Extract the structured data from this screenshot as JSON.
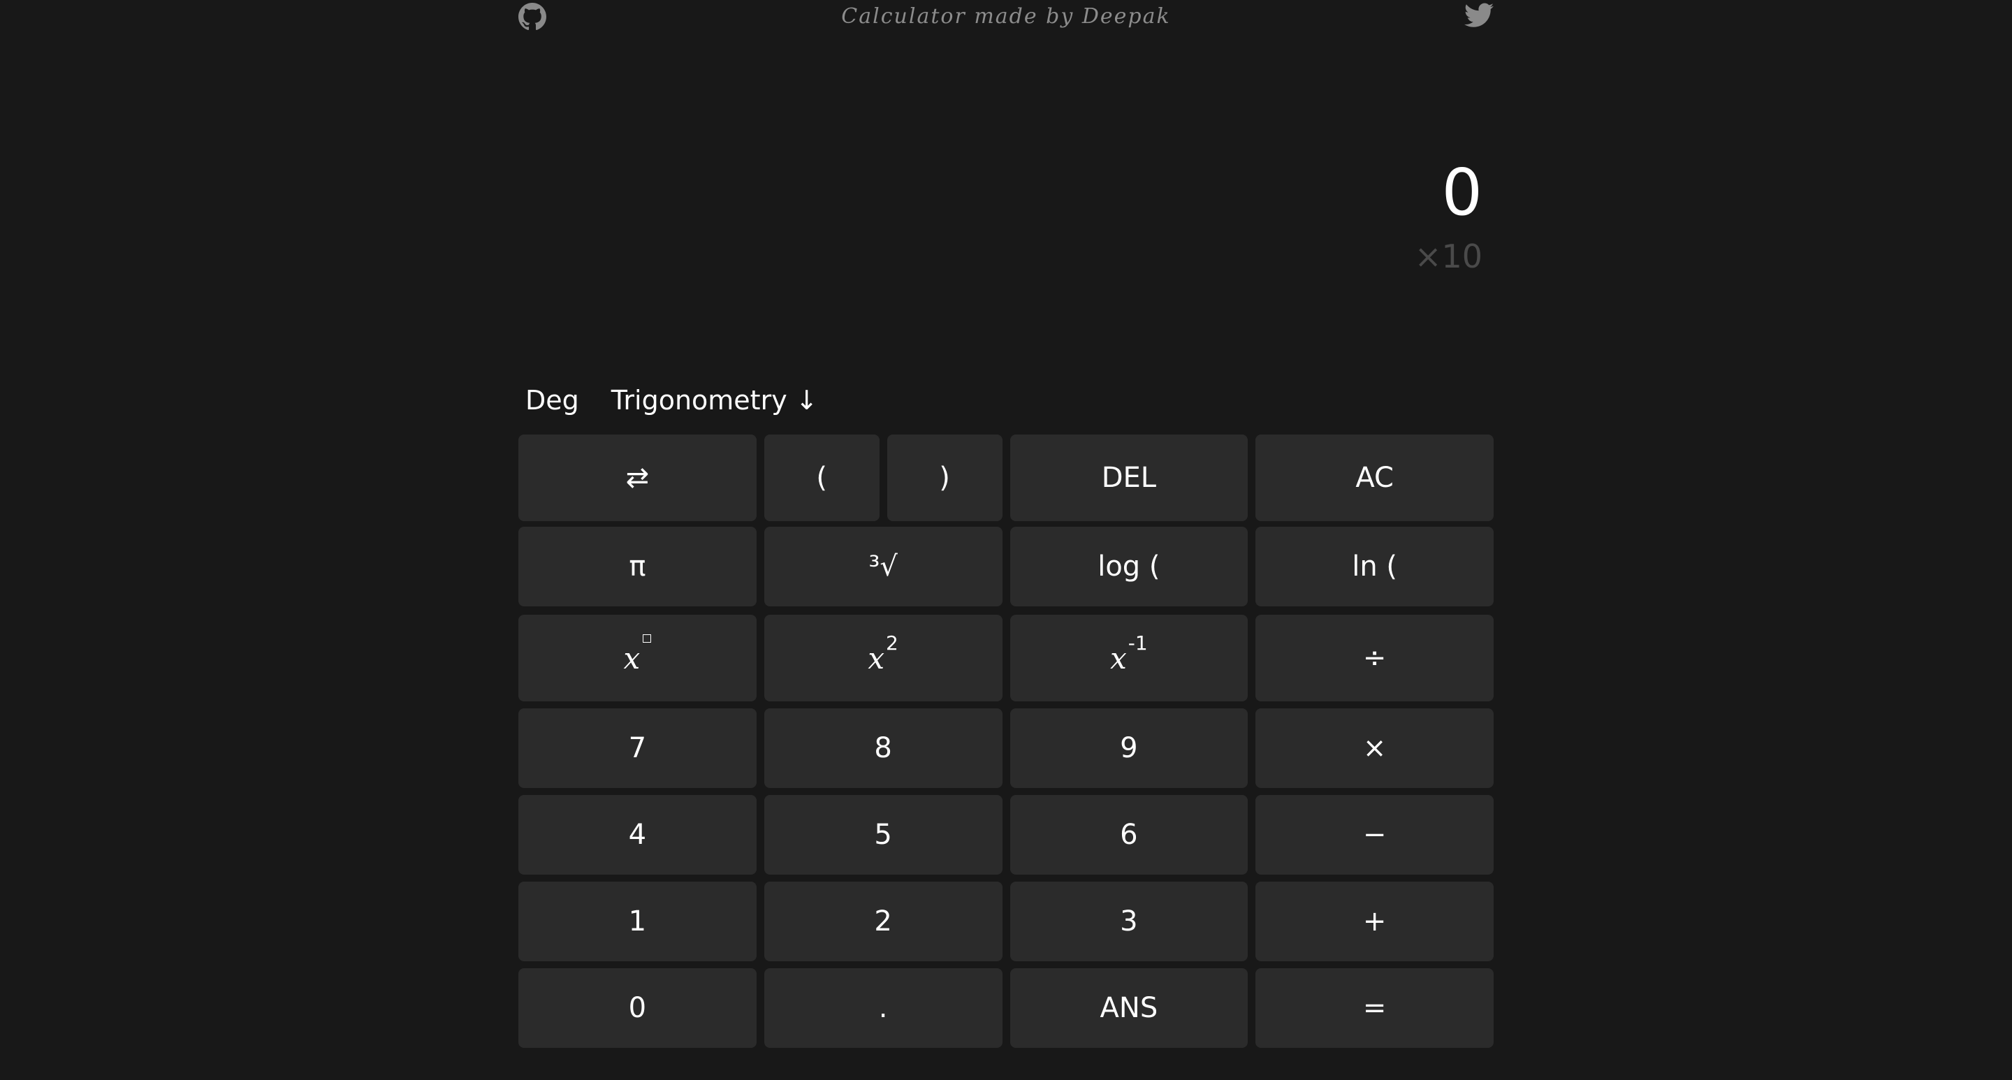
{
  "header": {
    "credit": "Calculator made by Deepak",
    "github_icon": "github-icon",
    "twitter_icon": "twitter-icon"
  },
  "display": {
    "value": "0",
    "exponent": "×10"
  },
  "modes": {
    "angle": "Deg",
    "menu": "Trigonometry ↓"
  },
  "keys": {
    "swap": "⇄",
    "lparen": "(",
    "rparen": ")",
    "del": "DEL",
    "ac": "AC",
    "pi": "π",
    "cbrt": "³√",
    "log": "log (",
    "ln": "ln (",
    "pow_base": "x",
    "sq_base": "x",
    "sq_sup": "2",
    "inv_base": "x",
    "inv_sup": "-1",
    "divide": "÷",
    "seven": "7",
    "eight": "8",
    "nine": "9",
    "multiply": "×",
    "four": "4",
    "five": "5",
    "six": "6",
    "minus": "−",
    "one": "1",
    "two": "2",
    "three": "3",
    "plus": "+",
    "zero": "0",
    "dot": ".",
    "ans": "ANS",
    "equals": "="
  },
  "colors": {
    "background": "#181818",
    "key": "#2b2b2b",
    "muted": "#4a4a4a"
  }
}
